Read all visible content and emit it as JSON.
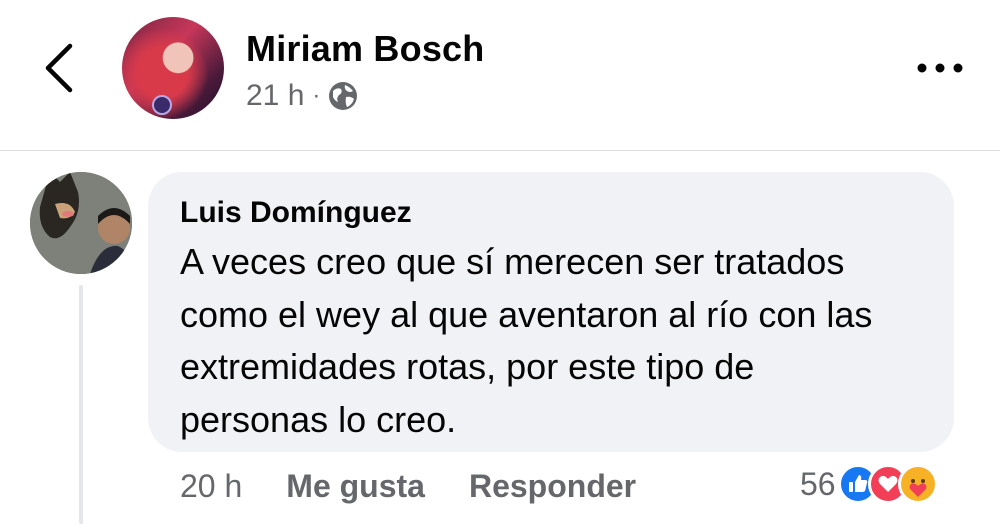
{
  "post": {
    "author": "Miriam Bosch",
    "time": "21 h",
    "separator": "·",
    "privacy_icon": "globe-icon",
    "back_icon": "chevron-left-icon",
    "more_icon": "more-horizontal-icon"
  },
  "comment": {
    "author": "Luis Domínguez",
    "lines": [
      "A veces creo que sí merecen ser tratados",
      "como el wey al que aventaron al río con las",
      "extremidades rotas, por este tipo de",
      "personas lo creo."
    ],
    "time": "20 h",
    "like_label": "Me gusta",
    "reply_label": "Responder",
    "reaction_count": "56",
    "reactions": [
      "like-icon",
      "love-icon",
      "care-icon"
    ]
  },
  "colors": {
    "text": "#050505",
    "secondary": "#65676b",
    "bubble": "#f0f2f5",
    "like_blue": "#1877f2",
    "love_red": "#f33e58",
    "care_yellow": "#f7b125"
  }
}
